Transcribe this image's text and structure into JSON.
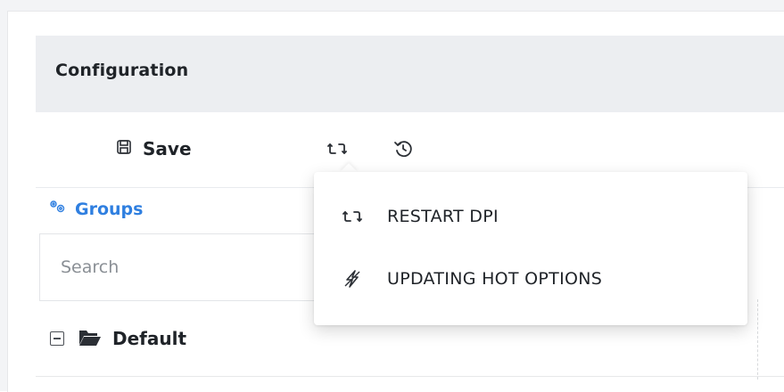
{
  "config": {
    "title": "Configuration"
  },
  "toolbar": {
    "save_label": "Save",
    "icons": [
      "save-icon",
      "restart-icon",
      "history-icon"
    ]
  },
  "groups": {
    "label": "Groups",
    "icon": "gears-icon",
    "color": "#2f7fe0"
  },
  "search": {
    "placeholder": "Search",
    "value": ""
  },
  "tree": {
    "items": [
      {
        "label": "Default",
        "expanded": true,
        "icon": "folder-open-icon"
      }
    ]
  },
  "dropdown": {
    "items": [
      {
        "label": "RESTART DPI",
        "icon": "restart-icon"
      },
      {
        "label": "UPDATING HOT OPTIONS",
        "icon": "bolt-icon"
      }
    ]
  }
}
